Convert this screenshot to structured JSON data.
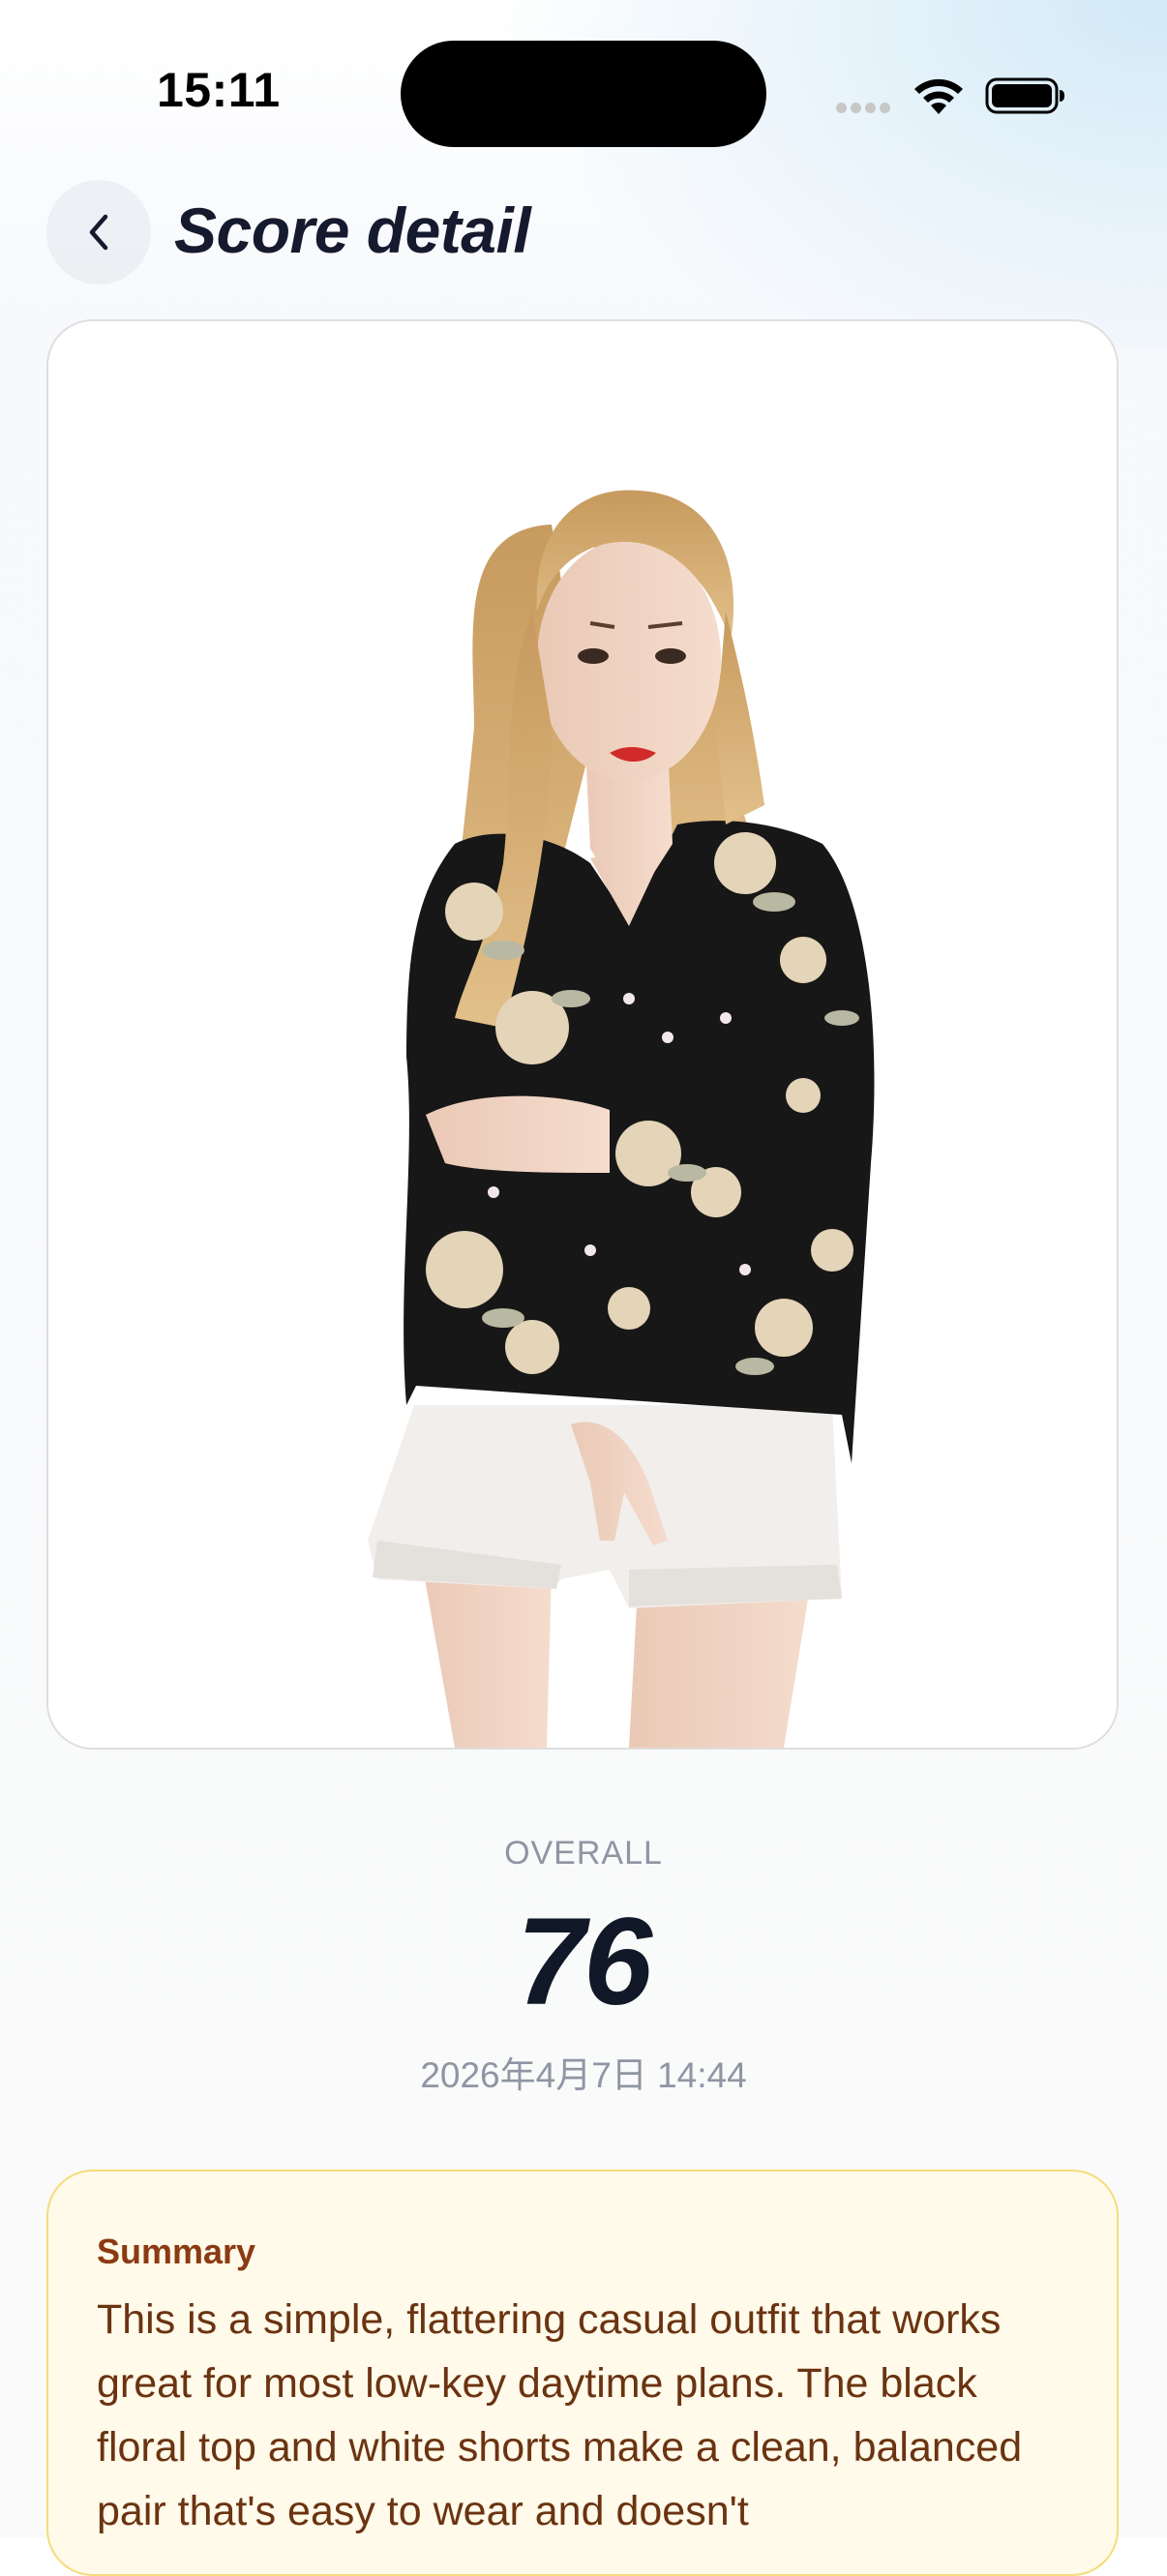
{
  "status_bar": {
    "time": "15:11"
  },
  "header": {
    "back_icon": "chevron-left-icon",
    "title": "Score detail"
  },
  "photo": {
    "description_icon": "outfit-photo"
  },
  "score": {
    "label": "OVERALL",
    "value": "76",
    "date": "2026年4月7日 14:44"
  },
  "summary": {
    "title": "Summary",
    "text": "This is a simple, flattering casual outfit that works great for most low-key daytime plans. The black floral top and white shorts make a clean, balanced pair that's easy to wear and doesn't"
  },
  "colors": {
    "title": "#161a2e",
    "score": "#111827",
    "muted": "#8f95a3",
    "summary_bg": "#fffaea",
    "summary_border": "#f6dc7a",
    "summary_title": "#8b3a12",
    "summary_text": "#6b3311"
  }
}
